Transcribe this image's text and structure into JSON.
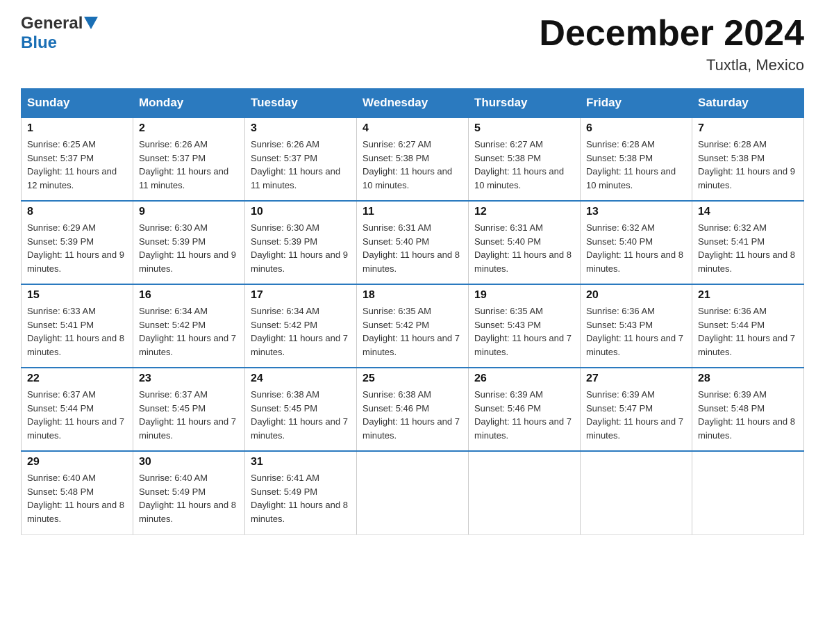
{
  "header": {
    "logo": {
      "general": "General",
      "blue": "Blue"
    },
    "title": "December 2024",
    "location": "Tuxtla, Mexico"
  },
  "days_of_week": [
    "Sunday",
    "Monday",
    "Tuesday",
    "Wednesday",
    "Thursday",
    "Friday",
    "Saturday"
  ],
  "weeks": [
    [
      {
        "day": "1",
        "sunrise": "Sunrise: 6:25 AM",
        "sunset": "Sunset: 5:37 PM",
        "daylight": "Daylight: 11 hours and 12 minutes."
      },
      {
        "day": "2",
        "sunrise": "Sunrise: 6:26 AM",
        "sunset": "Sunset: 5:37 PM",
        "daylight": "Daylight: 11 hours and 11 minutes."
      },
      {
        "day": "3",
        "sunrise": "Sunrise: 6:26 AM",
        "sunset": "Sunset: 5:37 PM",
        "daylight": "Daylight: 11 hours and 11 minutes."
      },
      {
        "day": "4",
        "sunrise": "Sunrise: 6:27 AM",
        "sunset": "Sunset: 5:38 PM",
        "daylight": "Daylight: 11 hours and 10 minutes."
      },
      {
        "day": "5",
        "sunrise": "Sunrise: 6:27 AM",
        "sunset": "Sunset: 5:38 PM",
        "daylight": "Daylight: 11 hours and 10 minutes."
      },
      {
        "day": "6",
        "sunrise": "Sunrise: 6:28 AM",
        "sunset": "Sunset: 5:38 PM",
        "daylight": "Daylight: 11 hours and 10 minutes."
      },
      {
        "day": "7",
        "sunrise": "Sunrise: 6:28 AM",
        "sunset": "Sunset: 5:38 PM",
        "daylight": "Daylight: 11 hours and 9 minutes."
      }
    ],
    [
      {
        "day": "8",
        "sunrise": "Sunrise: 6:29 AM",
        "sunset": "Sunset: 5:39 PM",
        "daylight": "Daylight: 11 hours and 9 minutes."
      },
      {
        "day": "9",
        "sunrise": "Sunrise: 6:30 AM",
        "sunset": "Sunset: 5:39 PM",
        "daylight": "Daylight: 11 hours and 9 minutes."
      },
      {
        "day": "10",
        "sunrise": "Sunrise: 6:30 AM",
        "sunset": "Sunset: 5:39 PM",
        "daylight": "Daylight: 11 hours and 9 minutes."
      },
      {
        "day": "11",
        "sunrise": "Sunrise: 6:31 AM",
        "sunset": "Sunset: 5:40 PM",
        "daylight": "Daylight: 11 hours and 8 minutes."
      },
      {
        "day": "12",
        "sunrise": "Sunrise: 6:31 AM",
        "sunset": "Sunset: 5:40 PM",
        "daylight": "Daylight: 11 hours and 8 minutes."
      },
      {
        "day": "13",
        "sunrise": "Sunrise: 6:32 AM",
        "sunset": "Sunset: 5:40 PM",
        "daylight": "Daylight: 11 hours and 8 minutes."
      },
      {
        "day": "14",
        "sunrise": "Sunrise: 6:32 AM",
        "sunset": "Sunset: 5:41 PM",
        "daylight": "Daylight: 11 hours and 8 minutes."
      }
    ],
    [
      {
        "day": "15",
        "sunrise": "Sunrise: 6:33 AM",
        "sunset": "Sunset: 5:41 PM",
        "daylight": "Daylight: 11 hours and 8 minutes."
      },
      {
        "day": "16",
        "sunrise": "Sunrise: 6:34 AM",
        "sunset": "Sunset: 5:42 PM",
        "daylight": "Daylight: 11 hours and 7 minutes."
      },
      {
        "day": "17",
        "sunrise": "Sunrise: 6:34 AM",
        "sunset": "Sunset: 5:42 PM",
        "daylight": "Daylight: 11 hours and 7 minutes."
      },
      {
        "day": "18",
        "sunrise": "Sunrise: 6:35 AM",
        "sunset": "Sunset: 5:42 PM",
        "daylight": "Daylight: 11 hours and 7 minutes."
      },
      {
        "day": "19",
        "sunrise": "Sunrise: 6:35 AM",
        "sunset": "Sunset: 5:43 PM",
        "daylight": "Daylight: 11 hours and 7 minutes."
      },
      {
        "day": "20",
        "sunrise": "Sunrise: 6:36 AM",
        "sunset": "Sunset: 5:43 PM",
        "daylight": "Daylight: 11 hours and 7 minutes."
      },
      {
        "day": "21",
        "sunrise": "Sunrise: 6:36 AM",
        "sunset": "Sunset: 5:44 PM",
        "daylight": "Daylight: 11 hours and 7 minutes."
      }
    ],
    [
      {
        "day": "22",
        "sunrise": "Sunrise: 6:37 AM",
        "sunset": "Sunset: 5:44 PM",
        "daylight": "Daylight: 11 hours and 7 minutes."
      },
      {
        "day": "23",
        "sunrise": "Sunrise: 6:37 AM",
        "sunset": "Sunset: 5:45 PM",
        "daylight": "Daylight: 11 hours and 7 minutes."
      },
      {
        "day": "24",
        "sunrise": "Sunrise: 6:38 AM",
        "sunset": "Sunset: 5:45 PM",
        "daylight": "Daylight: 11 hours and 7 minutes."
      },
      {
        "day": "25",
        "sunrise": "Sunrise: 6:38 AM",
        "sunset": "Sunset: 5:46 PM",
        "daylight": "Daylight: 11 hours and 7 minutes."
      },
      {
        "day": "26",
        "sunrise": "Sunrise: 6:39 AM",
        "sunset": "Sunset: 5:46 PM",
        "daylight": "Daylight: 11 hours and 7 minutes."
      },
      {
        "day": "27",
        "sunrise": "Sunrise: 6:39 AM",
        "sunset": "Sunset: 5:47 PM",
        "daylight": "Daylight: 11 hours and 7 minutes."
      },
      {
        "day": "28",
        "sunrise": "Sunrise: 6:39 AM",
        "sunset": "Sunset: 5:48 PM",
        "daylight": "Daylight: 11 hours and 8 minutes."
      }
    ],
    [
      {
        "day": "29",
        "sunrise": "Sunrise: 6:40 AM",
        "sunset": "Sunset: 5:48 PM",
        "daylight": "Daylight: 11 hours and 8 minutes."
      },
      {
        "day": "30",
        "sunrise": "Sunrise: 6:40 AM",
        "sunset": "Sunset: 5:49 PM",
        "daylight": "Daylight: 11 hours and 8 minutes."
      },
      {
        "day": "31",
        "sunrise": "Sunrise: 6:41 AM",
        "sunset": "Sunset: 5:49 PM",
        "daylight": "Daylight: 11 hours and 8 minutes."
      },
      null,
      null,
      null,
      null
    ]
  ]
}
